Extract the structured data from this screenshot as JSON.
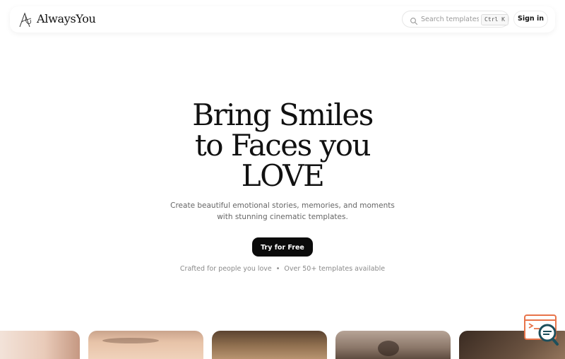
{
  "header": {
    "logo_text": "AlwaysYou",
    "search": {
      "placeholder": "Search templates",
      "shortcut": "Ctrl K"
    },
    "signin_label": "Sign in"
  },
  "hero": {
    "title_lines": [
      "Bring Smiles",
      "to Faces you",
      "LOVE"
    ],
    "subtitle_lines": [
      "Create beautiful emotional stories, memories, and moments",
      "with stunning cinematic templates."
    ],
    "cta_label": "Try for Free",
    "tagline_left": "Crafted for people you love",
    "tagline_sep": "•",
    "tagline_right": "Over 50+ templates available"
  },
  "icons": {
    "logo": "logo-mark-icon",
    "search": "search-icon",
    "widget": "chat-search-widget-icon"
  },
  "colors": {
    "background": "#ffffff",
    "cta": "#0b0b0b",
    "text": "#111111",
    "muted": "#8a8a8a",
    "widget_accent": "#e8744a"
  }
}
